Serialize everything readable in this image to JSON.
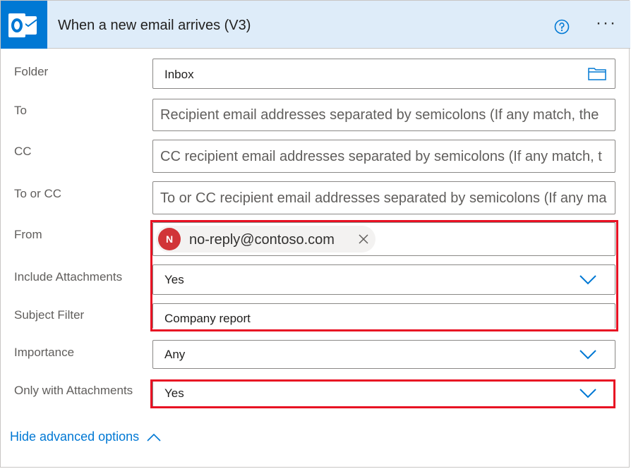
{
  "header": {
    "title": "When a new email arrives (V3)",
    "app_icon": "outlook-icon",
    "help_icon": "help-circle-icon",
    "more_label": "···",
    "accent": "#0078d4",
    "background": "#deecf9"
  },
  "fields": {
    "folder": {
      "label": "Folder",
      "value": "Inbox",
      "icon": "folder-icon"
    },
    "to": {
      "label": "To",
      "placeholder": "Recipient email addresses separated by semicolons (If any match, the"
    },
    "cc": {
      "label": "CC",
      "placeholder": "CC recipient email addresses separated by semicolons (If any match, t"
    },
    "to_or_cc": {
      "label": "To or CC",
      "placeholder": "To or CC recipient email addresses separated by semicolons (If any ma"
    },
    "from": {
      "label": "From",
      "chip_initial": "N",
      "chip_value": "no-reply@contoso.com",
      "chip_color": "#d13438"
    },
    "include_attachments": {
      "label": "Include Attachments",
      "value": "Yes"
    },
    "subject_filter": {
      "label": "Subject Filter",
      "value": "Company report"
    },
    "importance": {
      "label": "Importance",
      "value": "Any"
    },
    "only_with_attachments": {
      "label": "Only with Attachments",
      "value": "Yes"
    }
  },
  "highlight_color": "#e81123",
  "advanced": {
    "label": "Hide advanced options"
  }
}
